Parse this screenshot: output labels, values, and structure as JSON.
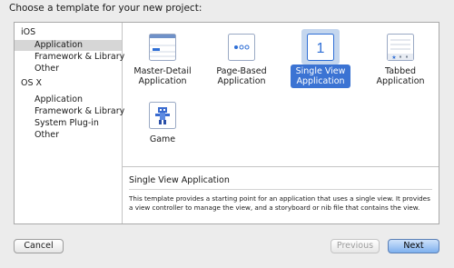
{
  "header": {
    "title": "Choose a template for your new project:"
  },
  "sidebar": {
    "items": [
      {
        "label": "iOS"
      },
      {
        "label": "Application"
      },
      {
        "label": "Framework & Library"
      },
      {
        "label": "Other"
      },
      {
        "label": "OS X"
      },
      {
        "label": "Application"
      },
      {
        "label": "Framework & Library"
      },
      {
        "label": "System Plug-in"
      },
      {
        "label": "Other"
      }
    ],
    "selected": "Application"
  },
  "templates": [
    {
      "line1": "Master-Detail",
      "line2": "Application",
      "icon": "master-detail-icon"
    },
    {
      "line1": "Page-Based",
      "line2": "Application",
      "icon": "page-based-icon"
    },
    {
      "line1": "Single View",
      "line2": "Application",
      "icon": "single-view-icon",
      "icon_text": "1"
    },
    {
      "line1": "Tabbed",
      "line2": "Application",
      "icon": "tabbed-icon"
    },
    {
      "line1": "Game",
      "line2": "",
      "icon": "game-icon"
    }
  ],
  "description": {
    "title": "Single View Application",
    "line1": "This template provides a starting point for an application that uses a single view. It provides",
    "line2": "a view controller to manage the view, and a storyboard or nib file that contains the view."
  },
  "buttons": {
    "cancel": "Cancel",
    "previous": "Previous",
    "next": "Next"
  },
  "colors": {
    "selection": "#3b73d3",
    "selection_bg": "#c4d6ee",
    "sidebar_selected": "#d6d6d6"
  }
}
